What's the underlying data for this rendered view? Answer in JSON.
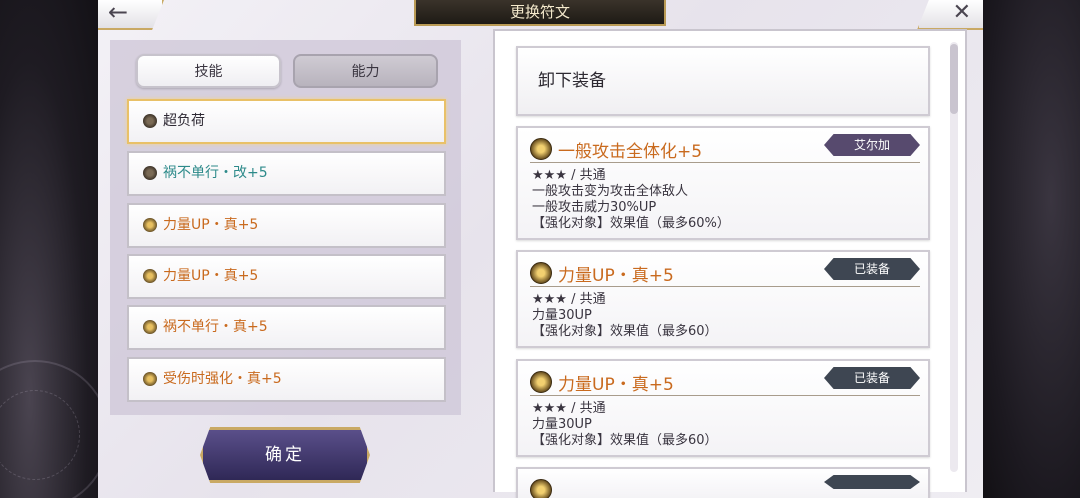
{
  "title": "更换符文",
  "nav": {
    "back_icon": "←",
    "close_icon": "✕"
  },
  "tabs": [
    {
      "label": "技能"
    },
    {
      "label": "能力"
    }
  ],
  "rune_list": [
    {
      "label": "超负荷"
    },
    {
      "label": "祸不单行・改+5"
    },
    {
      "label": "力量UP・真+5"
    },
    {
      "label": "力量UP・真+5"
    },
    {
      "label": "祸不单行・真+5"
    },
    {
      "label": "受伤时强化・真+5"
    }
  ],
  "confirm_label": "确定",
  "unequip_label": "卸下装备",
  "cards": [
    {
      "name": "一般攻击全体化+5",
      "badge": "艾尔加",
      "lines": [
        "★★★ / 共通",
        "一般攻击变为攻击全体敌人",
        "一般攻击威力30%UP",
        "【强化对象】效果值（最多60%）"
      ]
    },
    {
      "name": "力量UP・真+5",
      "badge": "已装备",
      "lines": [
        "★★★ / 共通",
        "力量30UP",
        "【强化对象】效果值（最多60）"
      ]
    },
    {
      "name": "力量UP・真+5",
      "badge": "已装备",
      "lines": [
        "★★★ / 共通",
        "力量30UP",
        "【强化对象】效果值（最多60）"
      ]
    }
  ],
  "colors": {
    "accent_gold": "#c9a964",
    "rune_orange": "#c96a1e",
    "rune_teal": "#2d8a8a",
    "confirm_purple": "#4a4078"
  }
}
